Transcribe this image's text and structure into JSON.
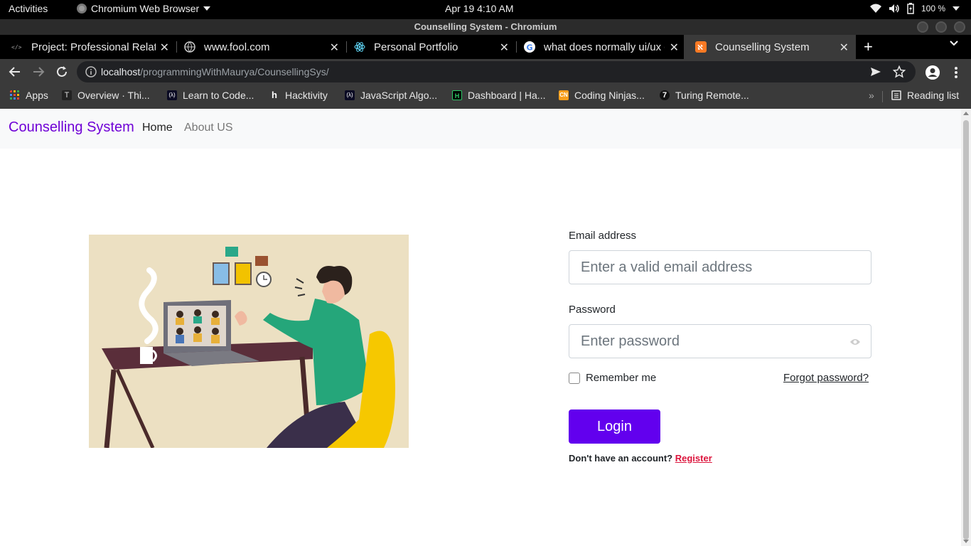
{
  "system_bar": {
    "activities": "Activities",
    "app_menu": "Chromium Web Browser",
    "clock": "Apr 19   4:10 AM",
    "battery": "100 %"
  },
  "window": {
    "title": "Counselling System - Chromium"
  },
  "tabs": [
    {
      "label": "Project: Professional Relati",
      "icon": "code-icon"
    },
    {
      "label": "www.fool.com",
      "icon": "globe-icon"
    },
    {
      "label": "Personal Portfolio",
      "icon": "react-icon"
    },
    {
      "label": "what does normally ui/ux d",
      "icon": "google-icon"
    },
    {
      "label": "Counselling System",
      "icon": "xampp-icon",
      "active": true
    }
  ],
  "toolbar": {
    "url_host": "localhost",
    "url_path": "/programmingWithMaurya/CounsellingSys/"
  },
  "bookmarks": {
    "items": [
      {
        "label": "Apps"
      },
      {
        "label": "Overview · Thi..."
      },
      {
        "label": "Learn to Code..."
      },
      {
        "label": "Hacktivity"
      },
      {
        "label": "JavaScript Algo..."
      },
      {
        "label": "Dashboard | Ha..."
      },
      {
        "label": "Coding Ninjas..."
      },
      {
        "label": "Turing Remote..."
      }
    ],
    "more": "»",
    "reading_list": "Reading list"
  },
  "page": {
    "brand": "Counselling System",
    "nav": {
      "home": "Home",
      "about": "About US"
    },
    "form": {
      "email_label": "Email address",
      "email_placeholder": "Enter a valid email address",
      "password_label": "Password",
      "password_placeholder": "Enter password",
      "remember": "Remember me",
      "forgot": "Forgot password?",
      "login": "Login",
      "signup_prompt": "Don't have an account?",
      "register": "Register"
    },
    "colors": {
      "brand": "#6f00d6",
      "login_button": "#6200ee",
      "register_link": "#dc143c",
      "illustration_bg": "#ece0c2"
    }
  }
}
